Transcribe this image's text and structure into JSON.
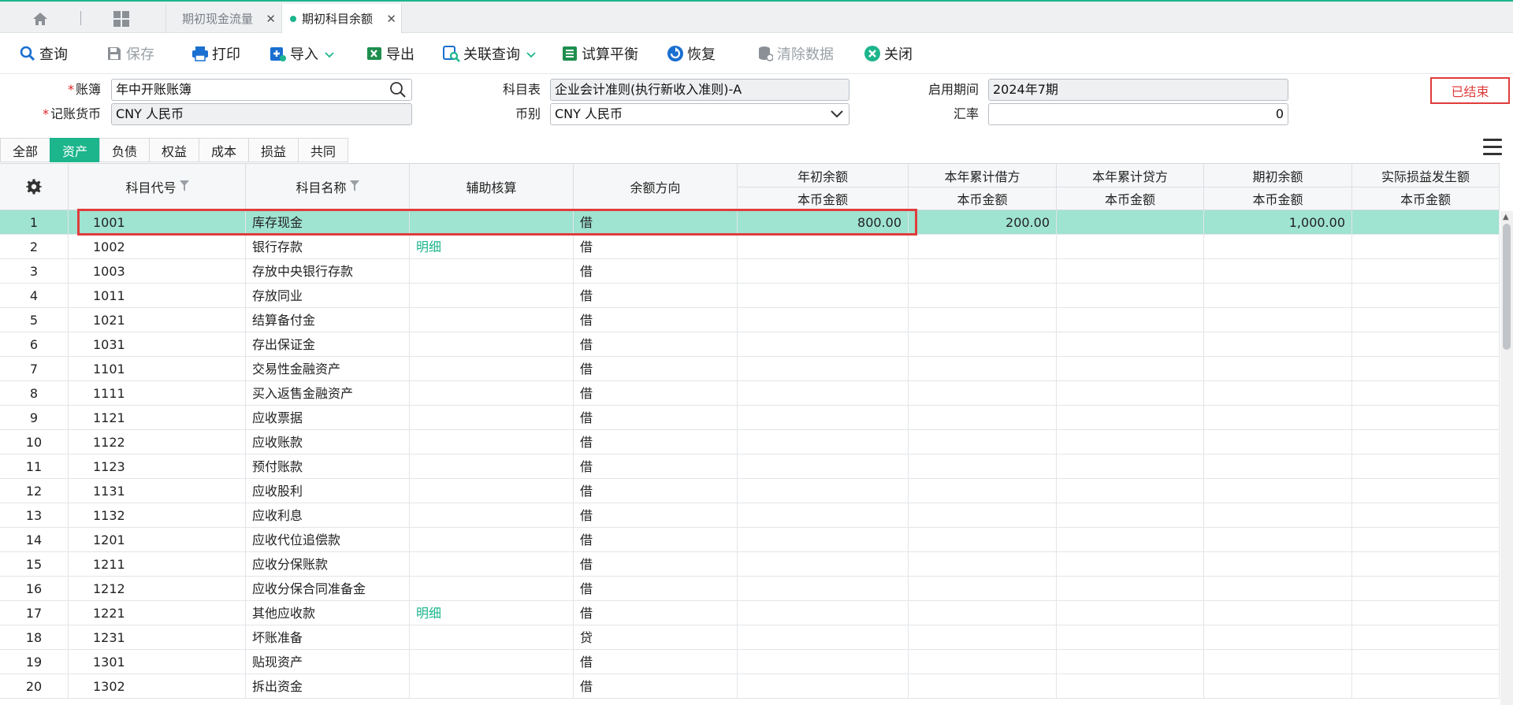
{
  "tabs": [
    {
      "label": "期初现金流量"
    },
    {
      "label": "期初科目余额"
    }
  ],
  "toolbar": {
    "query": "查询",
    "save": "保存",
    "print": "打印",
    "import": "导入",
    "export": "导出",
    "related_query": "关联查询",
    "trial_balance": "试算平衡",
    "restore": "恢复",
    "clear_data": "清除数据",
    "close": "关闭"
  },
  "form": {
    "ledger_label": "账簿",
    "ledger_value": "年中开账账簿",
    "currency_label": "记账货币",
    "currency_value": "CNY 人民币",
    "chart_label": "科目表",
    "chart_value": "企业会计准则(执行新收入准则)-A",
    "coin_label": "币别",
    "coin_value": "CNY 人民币",
    "period_label": "启用期间",
    "period_value": "2024年7期",
    "rate_label": "汇率",
    "rate_value": "0",
    "status": "已结束"
  },
  "category_tabs": [
    "全部",
    "资产",
    "负债",
    "权益",
    "成本",
    "损益",
    "共同"
  ],
  "active_category": "资产",
  "columns": {
    "code": "科目代号",
    "name": "科目名称",
    "aux": "辅助核算",
    "direction": "余额方向",
    "year_begin": "年初余额",
    "debit": "本年累计借方",
    "credit": "本年累计贷方",
    "period_begin": "期初余额",
    "actual_pl": "实际损益发生额",
    "sub": "本币金额"
  },
  "rows": [
    {
      "no": "1",
      "code": "1001",
      "name": "库存现金",
      "aux": "",
      "dir": "借",
      "year_begin": "800.00",
      "debit": "200.00",
      "credit": "",
      "period_begin": "1,000.00",
      "pl": ""
    },
    {
      "no": "2",
      "code": "1002",
      "name": "银行存款",
      "aux": "明细",
      "dir": "借",
      "year_begin": "",
      "debit": "",
      "credit": "",
      "period_begin": "",
      "pl": ""
    },
    {
      "no": "3",
      "code": "1003",
      "name": "存放中央银行存款",
      "aux": "",
      "dir": "借",
      "year_begin": "",
      "debit": "",
      "credit": "",
      "period_begin": "",
      "pl": ""
    },
    {
      "no": "4",
      "code": "1011",
      "name": "存放同业",
      "aux": "",
      "dir": "借",
      "year_begin": "",
      "debit": "",
      "credit": "",
      "period_begin": "",
      "pl": ""
    },
    {
      "no": "5",
      "code": "1021",
      "name": "结算备付金",
      "aux": "",
      "dir": "借",
      "year_begin": "",
      "debit": "",
      "credit": "",
      "period_begin": "",
      "pl": ""
    },
    {
      "no": "6",
      "code": "1031",
      "name": "存出保证金",
      "aux": "",
      "dir": "借",
      "year_begin": "",
      "debit": "",
      "credit": "",
      "period_begin": "",
      "pl": ""
    },
    {
      "no": "7",
      "code": "1101",
      "name": "交易性金融资产",
      "aux": "",
      "dir": "借",
      "year_begin": "",
      "debit": "",
      "credit": "",
      "period_begin": "",
      "pl": ""
    },
    {
      "no": "8",
      "code": "1111",
      "name": "买入返售金融资产",
      "aux": "",
      "dir": "借",
      "year_begin": "",
      "debit": "",
      "credit": "",
      "period_begin": "",
      "pl": ""
    },
    {
      "no": "9",
      "code": "1121",
      "name": "应收票据",
      "aux": "",
      "dir": "借",
      "year_begin": "",
      "debit": "",
      "credit": "",
      "period_begin": "",
      "pl": ""
    },
    {
      "no": "10",
      "code": "1122",
      "name": "应收账款",
      "aux": "",
      "dir": "借",
      "year_begin": "",
      "debit": "",
      "credit": "",
      "period_begin": "",
      "pl": ""
    },
    {
      "no": "11",
      "code": "1123",
      "name": "预付账款",
      "aux": "",
      "dir": "借",
      "year_begin": "",
      "debit": "",
      "credit": "",
      "period_begin": "",
      "pl": ""
    },
    {
      "no": "12",
      "code": "1131",
      "name": "应收股利",
      "aux": "",
      "dir": "借",
      "year_begin": "",
      "debit": "",
      "credit": "",
      "period_begin": "",
      "pl": ""
    },
    {
      "no": "13",
      "code": "1132",
      "name": "应收利息",
      "aux": "",
      "dir": "借",
      "year_begin": "",
      "debit": "",
      "credit": "",
      "period_begin": "",
      "pl": ""
    },
    {
      "no": "14",
      "code": "1201",
      "name": "应收代位追偿款",
      "aux": "",
      "dir": "借",
      "year_begin": "",
      "debit": "",
      "credit": "",
      "period_begin": "",
      "pl": ""
    },
    {
      "no": "15",
      "code": "1211",
      "name": "应收分保账款",
      "aux": "",
      "dir": "借",
      "year_begin": "",
      "debit": "",
      "credit": "",
      "period_begin": "",
      "pl": ""
    },
    {
      "no": "16",
      "code": "1212",
      "name": "应收分保合同准备金",
      "aux": "",
      "dir": "借",
      "year_begin": "",
      "debit": "",
      "credit": "",
      "period_begin": "",
      "pl": ""
    },
    {
      "no": "17",
      "code": "1221",
      "name": "其他应收款",
      "aux": "明细",
      "dir": "借",
      "year_begin": "",
      "debit": "",
      "credit": "",
      "period_begin": "",
      "pl": ""
    },
    {
      "no": "18",
      "code": "1231",
      "name": "坏账准备",
      "aux": "",
      "dir": "贷",
      "year_begin": "",
      "debit": "",
      "credit": "",
      "period_begin": "",
      "pl": ""
    },
    {
      "no": "19",
      "code": "1301",
      "name": "贴现资产",
      "aux": "",
      "dir": "借",
      "year_begin": "",
      "debit": "",
      "credit": "",
      "period_begin": "",
      "pl": ""
    },
    {
      "no": "20",
      "code": "1302",
      "name": "拆出资金",
      "aux": "",
      "dir": "借",
      "year_begin": "",
      "debit": "",
      "credit": "",
      "period_begin": "",
      "pl": ""
    }
  ],
  "selected_row": 0,
  "colors": {
    "accent": "#1cb58c",
    "selected_row": "#9fe3d1",
    "alert": "#e03c3c"
  }
}
